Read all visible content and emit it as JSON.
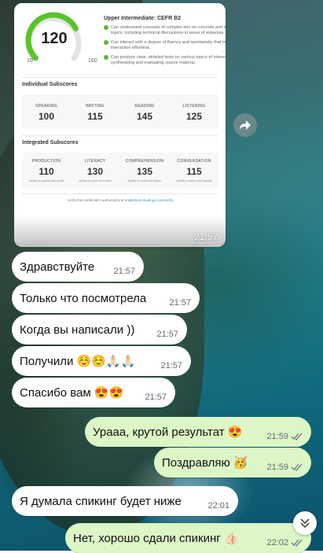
{
  "certificate": {
    "score": "120",
    "min": "10",
    "max": "160",
    "score_fraction": 0.733,
    "level_title": "Upper Intermediate: CEFR B2",
    "descriptors": [
      "Can understand concepts of complex text on concrete and abstract topics, including technical discussions in areas of expertise.",
      "Can interact with a degree of fluency and spontaneity that makes regular interaction effortless.",
      "Can produce clear, detailed texts on various topics of interest, synthesizing and evaluating source material."
    ],
    "individual_title": "Individual Subscores",
    "individual": [
      {
        "label": "SPEAKING",
        "value": "100"
      },
      {
        "label": "WRITING",
        "value": "115"
      },
      {
        "label": "READING",
        "value": "145"
      },
      {
        "label": "LISTENING",
        "value": "125"
      }
    ],
    "integrated_title": "Integrated Subscores",
    "integrated": [
      {
        "label": "PRODUCTION",
        "value": "110",
        "caption": "Ability to speak and write"
      },
      {
        "label": "LITERACY",
        "value": "130",
        "caption": "Ability to write and read"
      },
      {
        "label": "COMPREHENSION",
        "value": "135",
        "caption": "Ability to read and listen"
      },
      {
        "label": "CONVERSATION",
        "value": "115",
        "caption": "Ability to listen and speak"
      }
    ],
    "verify_text": "Verify this certificate's authenticity at",
    "verify_link": "englishtest.duolingo.com/verify",
    "time": "21:57"
  },
  "messages": [
    {
      "dir": "in",
      "text": "Здравствуйте",
      "time": "21:57"
    },
    {
      "dir": "in",
      "text": "Только что посмотрела",
      "time": "21:57"
    },
    {
      "dir": "in",
      "text": "Когда вы написали ))",
      "time": "21:57"
    },
    {
      "dir": "in",
      "text": "Получили ☺️☺️🙏🏻🙏🏻",
      "time": "21:57"
    },
    {
      "dir": "in",
      "text": "Спасибо вам 😍😍",
      "time": "21:57"
    },
    {
      "dir": "out",
      "text": "Урааа, крутой результат 😍",
      "time": "21:59"
    },
    {
      "dir": "out",
      "text": "Поздравляю 🥳",
      "time": "21:59"
    },
    {
      "dir": "in",
      "text": "Я думала спикинг будет ниже",
      "time": "22:01"
    },
    {
      "dir": "out",
      "text": "Нет, хорошо сдали спикинг 👍🏻",
      "time": "22:02"
    }
  ],
  "colors": {
    "outgoing_bubble": "#dcf7c5",
    "incoming_bubble": "#ffffff",
    "gauge_fill": "#58c42a",
    "read_ticks": "#667788"
  },
  "icons": {
    "forward": "forward-arrow-icon",
    "scroll_down": "double-chevron-down-icon"
  }
}
